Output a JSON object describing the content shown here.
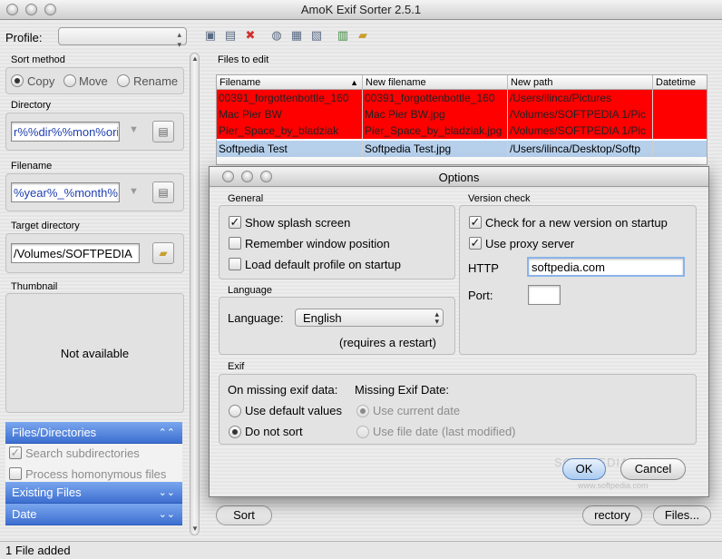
{
  "window": {
    "title": "AmoK Exif Sorter 2.5.1"
  },
  "profile": {
    "label": "Profile:",
    "value": ""
  },
  "sort_method": {
    "title": "Sort method",
    "options": [
      "Copy",
      "Move",
      "Rename"
    ],
    "selected": "Copy"
  },
  "directory": {
    "title": "Directory",
    "value": "r%%dir%%mon%ori"
  },
  "filename": {
    "title": "Filename",
    "value": "%year%_%month%_"
  },
  "target_directory": {
    "title": "Target directory",
    "value": "/Volumes/SOFTPEDIA"
  },
  "thumbnail": {
    "title": "Thumbnail",
    "placeholder": "Not available"
  },
  "sections": {
    "files_directories": "Files/Directories",
    "search_subdirectories": "Search subdirectories",
    "process_homonymous": "Process homonymous files",
    "existing_files": "Existing Files",
    "date": "Date"
  },
  "files_panel": {
    "title": "Files to edit",
    "columns": [
      "Filename",
      "New filename",
      "New path",
      "Datetime"
    ],
    "rows": [
      [
        "00391_forgottenbottle_160",
        "00391_forgottenbottle_160",
        "/Users/ilinca/Pictures",
        ""
      ],
      [
        "Mac Pier BW",
        "Mac Pier BW.jpg",
        "/Volumes/SOFTPEDIA 1/Pic",
        ""
      ],
      [
        "Pier_Space_by_bladziak",
        "Pier_Space_by_bladziak.jpg",
        "/Volumes/SOFTPEDIA 1/Pic",
        ""
      ],
      [
        "Softpedia Test",
        "Softpedia Test.jpg",
        "/Users/ilinca/Desktop/Softp",
        ""
      ]
    ]
  },
  "buttons": {
    "sort": "Sort",
    "directory": "rectory",
    "files": "Files..."
  },
  "status": {
    "text": "1 File added"
  },
  "options": {
    "title": "Options",
    "general": {
      "title": "General",
      "show_splash": "Show splash screen",
      "remember_window": "Remember window position",
      "load_default": "Load default profile on startup"
    },
    "language": {
      "title": "Language",
      "label": "Language:",
      "value": "English",
      "note": "(requires a restart)"
    },
    "version_check": {
      "title": "Version check",
      "check_new": "Check for a new version on startup",
      "use_proxy": "Use proxy server",
      "http_label": "HTTP",
      "http_value": "softpedia.com",
      "port_label": "Port:",
      "port_value": ""
    },
    "exif": {
      "title": "Exif",
      "on_missing": "On missing exif data:",
      "use_default": "Use default values",
      "do_not_sort": "Do not sort",
      "missing_date": "Missing Exif Date:",
      "use_current": "Use current date",
      "use_file_date": "Use file date (last modified)"
    },
    "ok": "OK",
    "cancel": "Cancel"
  },
  "watermark": {
    "name": "SOFTPEDIA",
    "url": "www.softpedia.com"
  },
  "colors": {
    "error_row": "#ff0000",
    "selected_row": "#b6d0ec",
    "accordion": "#4a7ad9"
  }
}
